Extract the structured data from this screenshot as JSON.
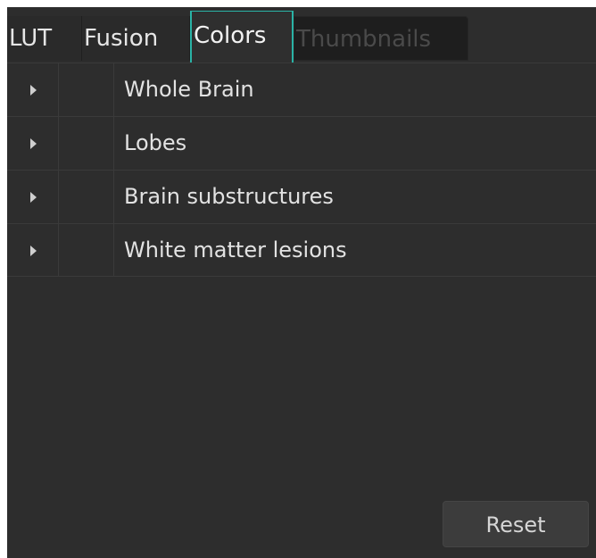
{
  "tabs": [
    {
      "label": "LUT",
      "active": false,
      "enabled": true
    },
    {
      "label": "Fusion",
      "active": false,
      "enabled": true
    },
    {
      "label": "Colors",
      "active": true,
      "enabled": true
    },
    {
      "label": "Thumbnails",
      "active": false,
      "enabled": false
    }
  ],
  "tree": {
    "rows": [
      {
        "label": "Whole Brain",
        "expand_icon": "caret-right-icon"
      },
      {
        "label": "Lobes",
        "expand_icon": "caret-right-icon"
      },
      {
        "label": "Brain substructures",
        "expand_icon": "caret-right-icon"
      },
      {
        "label": "White matter lesions",
        "expand_icon": "caret-right-icon"
      }
    ]
  },
  "footer": {
    "reset_label": "Reset"
  },
  "colors": {
    "accent": "#2ab3a6",
    "background": "#2d2d2d",
    "text": "#e2e2e2",
    "disabled_text": "#4a4a4a"
  }
}
